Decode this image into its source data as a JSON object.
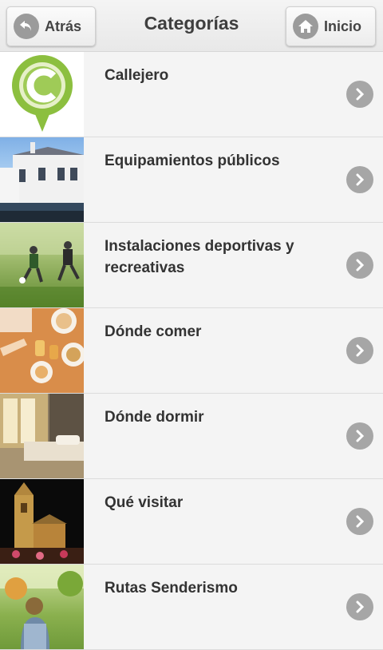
{
  "header": {
    "back_label": "Atrás",
    "title": "Categorías",
    "home_label": "Inicio"
  },
  "categories": [
    {
      "label": "Callejero",
      "icon": "map-pin-logo"
    },
    {
      "label": "Equipamientos públicos",
      "icon": "public-building-photo"
    },
    {
      "label": "Instalaciones deportivas y recreativas",
      "icon": "football-players-photo"
    },
    {
      "label": "Dónde comer",
      "icon": "restaurant-table-photo"
    },
    {
      "label": "Dónde dormir",
      "icon": "hotel-room-photo"
    },
    {
      "label": "Qué visitar",
      "icon": "church-tower-night-photo"
    },
    {
      "label": "Rutas Senderismo",
      "icon": "hiker-trail-photo"
    }
  ],
  "colors": {
    "accent_green": "#8cbf3f",
    "chevron_grey": "#a6a6a6"
  }
}
